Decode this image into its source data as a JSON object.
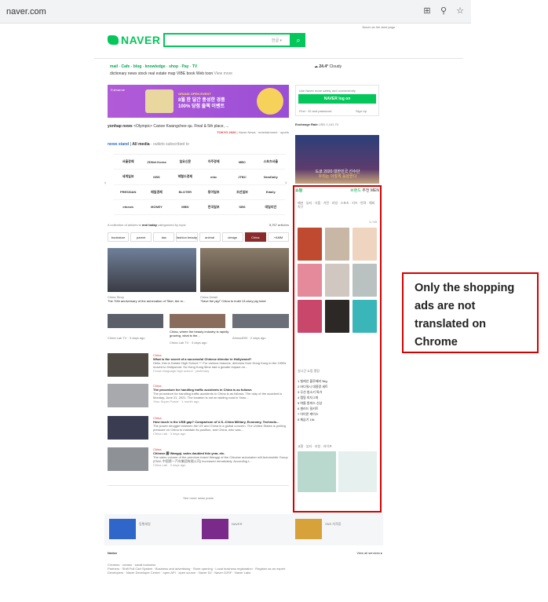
{
  "browser": {
    "url": "naver.com",
    "icons": [
      "translate-icon",
      "zoom-icon",
      "star-icon"
    ]
  },
  "top_links": "Naver as the start page  ·  ·",
  "logo": {
    "text": "NAVER"
  },
  "search": {
    "keyboard": "한글 ▾",
    "button_icon": "search-icon"
  },
  "services": {
    "line1": [
      "mail",
      "Cafe",
      "blog",
      "knowledge",
      "shop",
      "Pay",
      "TV"
    ],
    "line2": [
      "dictionary",
      "news",
      "stock",
      "real estate",
      "map",
      "VIBE",
      "book",
      "Web toon",
      "View more"
    ]
  },
  "weather": {
    "temp": "24.4°",
    "state": "Cloudy"
  },
  "banner": {
    "brand": "Fulmarme",
    "line1": "GRAND OPEN EVENT",
    "line2": "8월 한 달간 풍성한 경품",
    "line3": "100% 당첨 출첵 이벤트"
  },
  "news_ticker": {
    "source": "yonhap news",
    "headline": "<Olympic> Canoe Kwangchee qu. Final & 5th place, ...",
    "tag": "TOKYO 2020",
    "links": [
      "Naver News",
      "entertainment",
      "sports"
    ]
  },
  "newsstand": {
    "label": "news stand",
    "all_media": "All media",
    "subscribed": "outlets subscribed to",
    "outlets": [
      "서울경제",
      "ZDNet Korea",
      "일요신문",
      "아주경제",
      "MBC",
      "스포츠서울",
      "세계일보",
      "KBS",
      "헤럴드경제",
      "mbc",
      "JTBC",
      "NewDaily",
      "PRESSIAN",
      "매일경제",
      "BLOTER",
      "동아일보",
      "조선일보",
      "Edaily",
      "etnews",
      "MONEY",
      "MBN",
      "한국일보",
      "SBS",
      "데일리안"
    ]
  },
  "mtoday": {
    "collection": "A collection of articles to",
    "label": "mni today",
    "by": "categorized by topic",
    "count": "5,767 articles",
    "tabs": [
      "bookstore",
      "parent",
      "law",
      "fashion beauty",
      "animal",
      "design",
      "China",
      "+AMM"
    ],
    "active_tab": "China"
  },
  "photo_captions": {
    "left_src": "China Story",
    "left_title": "The 70th anniversary of the annexation of Tibet, the re...",
    "right_src": "China Detail",
    "right_title": "\"Save the pig!\" China to build 13-story pig hotel"
  },
  "mid_row": {
    "left": "China Lab TV · 3 days ago",
    "center": "China, where the beauty industry is rapidly growing, what is the...",
    "center_src": "China Lab TV · 3 days ago",
    "right": "Ahmad200 · 2 days ago"
  },
  "news_list": [
    {
      "src": "China",
      "title": "What is the secret of a successful Chinese director in Hollywood?",
      "snippet": "Hello, this is Harate High School ^^ For various reasons, directors from Hong Kong in the 1990s moved to Hollywood. So Hong Kong films had a greater impact on...",
      "meta": "Crown language high school · yesterday"
    },
    {
      "src": "China",
      "title": "The procedure for handling traffic accidents in China is as follows",
      "snippet": "The procedure for handling traffic accidents in China is as follows. The duty of the accident is Monday, June 21, 2021. The location is not an adding road in Yanu...",
      "meta": "Yiwu Super Power · 1 month ago"
    },
    {
      "src": "China",
      "title": "How much is the USB gap? Comparison of U.S.-China Military, Economy, Technolo...",
      "snippet": "The power struggle between the US and China is a global concern. The United States is putting pressure on China to maintain its position, and China, who was...",
      "meta": "China Lab · 3 days ago"
    },
    {
      "src": "China",
      "title": "Chinese 蔚 Wangqi, sales doubled this year, etc.",
      "snippet": "The sales volume of the premium brand Wangqi of the Chinese automaker will Automobile Group (FAW, 中国第一汽车集团有限公司) increased remarkably. According t...",
      "meta": "China Lab · 3 days ago"
    }
  ],
  "see_more": "See more news posts",
  "sidebar": {
    "login_hint": "Use Naver more safely and conveniently",
    "login_button": "NAVER log on",
    "find": "Find  ·  ID and password",
    "signup": "Sign Up",
    "exchange_label": "Exchange Rate",
    "exchange_value": "USD 1,141.70",
    "ad_line1": "도쿄 2020 대한민국 선수단",
    "ad_line2": "우리는 이렇게 응원한다"
  },
  "shopping": {
    "title": "쇼핑",
    "tabs": [
      "브랜드",
      "추천",
      "MEN"
    ],
    "cats": "패션 · 뷰티 · 식품 · 가전 · 리빙 · 스포츠 · 키즈 · 반려 · 해외직구",
    "pager": "1 / 10",
    "rank_title": "실시간 쇼핑 랭킹",
    "ranks": [
      "1 칠레산 블루베리 5kg",
      "2 바디워시 대용량 세트",
      "3 무선 청소기 특가",
      "4 캠핑 의자 2개",
      "5 여름 원피스 신상",
      "6 샐러드 밀키트",
      "7 아이폰 케이스",
      "8 제습기 16L"
    ],
    "bottom_title": "교환 · 뷰티 · 리빙 · 라이프"
  },
  "annotation": {
    "line1": "Only the shopping",
    "line2": "ads are not",
    "line3": "translated on",
    "line4": "Chrome"
  },
  "footer": {
    "ad1": "동행세일",
    "ad2": "NAVER",
    "ad3": "SNS 자격증",
    "notice": "Notice",
    "view_all": "View all services ▸",
    "rows": [
      "Creators · creator · small business",
      "Partners · Shift Full Cart System · Business and advertising · Store opening · Local business registration · Register as an expert",
      "Developers · Naver Developer Center · open API · open source · Naver D2 · Naver D2SF · Naver Labs"
    ]
  },
  "colors": {
    "naver_green": "#03c75a",
    "annotation_red": "#d40000"
  }
}
